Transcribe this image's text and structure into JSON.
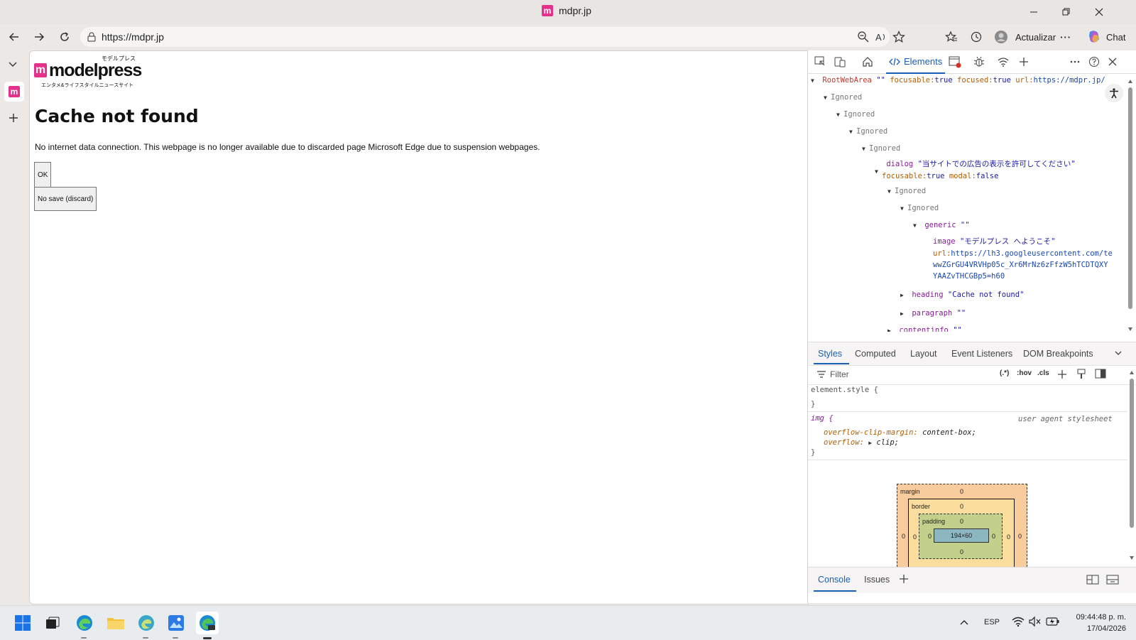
{
  "window": {
    "tab_title": "mdpr.jp",
    "favicon_letter": "m",
    "accent": "#e4318b"
  },
  "toolbar": {
    "url": "https://mdpr.jp",
    "update_label": "Actualizar",
    "chat_label": "Chat"
  },
  "page": {
    "logo_text": "modelpress",
    "logo_ruby": "モデルプレス",
    "logo_tagline": "エンタメ&ライフスタイルニュースサイト",
    "heading": "Cache not found",
    "paragraph": "No internet data connection. This webpage is no longer available due to discarded page Microsoft Edge due to suspension webpages.",
    "ok_label": "OK",
    "discard_label": "No save (discard)"
  },
  "devtools": {
    "elements_tab": "Elements",
    "tree": {
      "root_role": "RootWebArea",
      "root_name": "\"\"",
      "root_focusable_key": "focusable:",
      "root_focusable_val": "true",
      "root_focused_key": "focused:",
      "root_focused_val": "true",
      "root_url_key": "url:",
      "root_url_val": "https://mdpr.jp/",
      "ignored": "Ignored",
      "dialog_role": "dialog",
      "dialog_name": "\"当サイトでの広告の表示を許可してください\"",
      "dialog_focusable_key": "focusable:",
      "dialog_focusable_val": "true",
      "dialog_modal_key": "modal:",
      "dialog_modal_val": "false",
      "generic_role": "generic",
      "generic_name": "\"\"",
      "image_role": "image",
      "image_name": "\"モデルプレス へようこそ\"",
      "image_url_key": "url:",
      "image_url_1": "https://lh3.googleusercontent.com/te",
      "image_url_2": "wwZGrGU4VRVHp05c_Xr6MrNz6zFfzW5hTCDTQXY",
      "image_url_3": "YAAZvTHCGBp5=h60",
      "heading_role": "heading",
      "heading_name": "\"Cache not found\"",
      "paragraph_role": "paragraph",
      "paragraph_name": "\"\"",
      "contentinfo_role": "contentinfo",
      "contentinfo_name": "\"\""
    },
    "styles_tabs": [
      "Styles",
      "Computed",
      "Layout",
      "Event Listeners",
      "DOM Breakpoints"
    ],
    "filter_placeholder": "Filter",
    "filter_tools": {
      "regex": "(.*)",
      "hov": ":hov",
      "cls": ".cls"
    },
    "styles": {
      "element_style": "element.style {",
      "close_brace": "}",
      "img_selector": "img {",
      "ua_label": "user agent stylesheet",
      "prop1_name": "overflow-clip-margin:",
      "prop1_value": "content-box;",
      "prop2_name": "overflow:",
      "prop2_value": "clip;"
    },
    "boxmodel": {
      "margin_label": "margin",
      "border_label": "border",
      "padding_label": "padding",
      "zero": "0",
      "dash": "-",
      "content_size": "194×60"
    },
    "bottom_tabs": [
      "Console",
      "Issues"
    ]
  },
  "taskbar": {
    "language": "ESP",
    "time": "09:44:48 p. m.",
    "date": "17/04/2026"
  }
}
